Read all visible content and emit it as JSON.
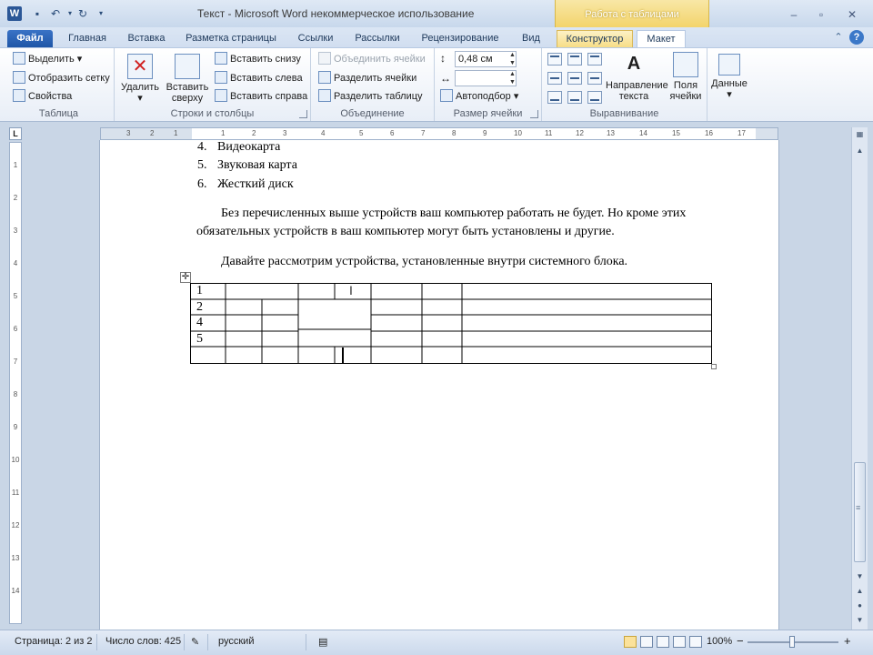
{
  "window": {
    "title": "Текст  -  Microsoft Word некоммерческое использование",
    "app_icon": "W",
    "context_tab_header": "Работа с таблицами"
  },
  "tabs": [
    {
      "label": "Файл"
    },
    {
      "label": "Главная"
    },
    {
      "label": "Вставка"
    },
    {
      "label": "Разметка страницы"
    },
    {
      "label": "Ссылки"
    },
    {
      "label": "Рассылки"
    },
    {
      "label": "Рецензирование"
    },
    {
      "label": "Вид"
    },
    {
      "label": "Конструктор"
    },
    {
      "label": "Макет"
    }
  ],
  "ribbon": {
    "table_group": {
      "label": "Таблица",
      "select": "Выделить",
      "show_grid": "Отобразить сетку",
      "properties": "Свойства"
    },
    "rows_cols_group": {
      "label": "Строки и столбцы",
      "delete": "Удалить",
      "insert_above": "Вставить сверху",
      "insert_below": "Вставить снизу",
      "insert_left": "Вставить слева",
      "insert_right": "Вставить справа"
    },
    "merge_group": {
      "label": "Объединение",
      "merge_cells": "Объединить ячейки",
      "split_cells": "Разделить ячейки",
      "split_table": "Разделить таблицу"
    },
    "cell_size_group": {
      "label": "Размер ячейки",
      "height_value": "0,48 см",
      "width_value": "",
      "autofit": "Автоподбор"
    },
    "alignment_group": {
      "label": "Выравнивание",
      "text_direction": "Направление текста",
      "cell_margins": "Поля ячейки"
    },
    "data_button": "Данные"
  },
  "ruler": {
    "h_ticks": [
      "3",
      "2",
      "1",
      "1",
      "2",
      "3",
      "4",
      "5",
      "6",
      "7",
      "8",
      "9",
      "10",
      "11",
      "12",
      "13",
      "14",
      "15",
      "16",
      "17"
    ],
    "v_ticks": [
      "1",
      "2",
      "3",
      "4",
      "5",
      "6",
      "7",
      "8",
      "9",
      "10",
      "11",
      "12",
      "13",
      "14"
    ]
  },
  "document": {
    "list": [
      {
        "num": "4.",
        "text": "Видеокарта"
      },
      {
        "num": "5.",
        "text": "Звуковая карта"
      },
      {
        "num": "6.",
        "text": "Жесткий диск"
      }
    ],
    "para1_line1": "Без перечисленных выше устройств ваш компьютер работать не будет. Но кроме этих",
    "para1_line2": "обязательных устройств в ваш компьютер могут быть установлены и другие.",
    "para2": "Давайте рассмотрим устройства, установленные внутри системного блока.",
    "table_cells": [
      "1",
      "2",
      "4",
      "5"
    ]
  },
  "statusbar": {
    "page": "Страница: 2 из 2",
    "words": "Число слов: 425",
    "language": "русский",
    "zoom": "100%",
    "zoom_minus": "−",
    "zoom_plus": "+"
  }
}
